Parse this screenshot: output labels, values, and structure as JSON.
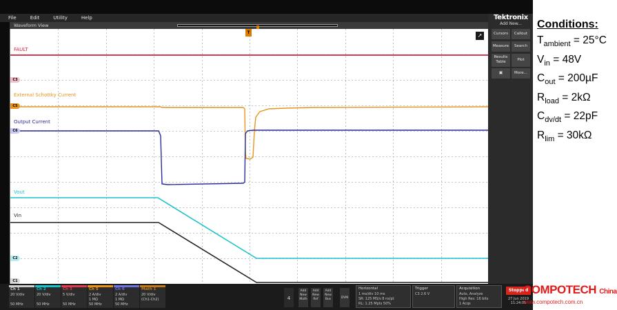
{
  "menu": [
    "File",
    "Edit",
    "Utility",
    "Help"
  ],
  "view_title": "Waveform View",
  "trigger_flag": "T",
  "brand": "Tektronix",
  "add_new": "Add New...",
  "side_buttons": [
    "Cursors",
    "Callout",
    "Measure",
    "Search",
    "Results Table",
    "Plot",
    "More..."
  ],
  "traces": {
    "fault": {
      "label": "FAULT",
      "color": "#d81b3c"
    },
    "schottky": {
      "label": "External Schottky Current",
      "color": "#e8941a"
    },
    "output": {
      "label": "Output Current",
      "color": "#27299b"
    },
    "vout": {
      "label": "Vout",
      "color": "#19c3cc"
    },
    "vin": {
      "label": "Vin",
      "color": "#222222"
    }
  },
  "ch_markers": [
    "C3",
    "C5",
    "C6",
    "C2",
    "C1"
  ],
  "channels": [
    {
      "name": "Ch 1",
      "color": "#cfcfcf",
      "lines": [
        "20 V/div",
        "",
        "50 MHz"
      ]
    },
    {
      "name": "Ch 2",
      "color": "#19c3cc",
      "lines": [
        "20 V/div",
        "",
        "50 MHz"
      ]
    },
    {
      "name": "Ch 3",
      "color": "#e23b52",
      "lines": [
        "5 V/div",
        "",
        "50 MHz"
      ]
    },
    {
      "name": "Ch 5",
      "color": "#e8941a",
      "lines": [
        "2 A/div",
        "1 MΩ",
        "50 MHz"
      ]
    },
    {
      "name": "Ch 6",
      "color": "#6f74e0",
      "lines": [
        "2 A/div",
        "1 MΩ",
        "50 MHz"
      ]
    },
    {
      "name": "Math 1",
      "color": "#c07a1c",
      "lines": [
        "20 V/div",
        "(Ch1-Ch2)",
        ""
      ]
    }
  ],
  "bottom_small": [
    "Add New Math",
    "Add New Ref",
    "Add New Bus",
    "DVM"
  ],
  "channel_count": "4",
  "horizontal": {
    "title": "Horizontal",
    "lines": [
      "1 ms/div      10 ms",
      "SR: 125 MS/s   8 ns/pt",
      "RL: 1.25 Mpts   50%"
    ]
  },
  "trigger": {
    "title": "Trigger",
    "lines": [
      "C3   2.6 V"
    ]
  },
  "acquisition": {
    "title": "Acquisition",
    "lines": [
      "Auto,      Analyze",
      "High Res: 16 bits",
      "1 Acqs"
    ]
  },
  "run_state": "Stopped",
  "date": "27 Jun 2019 11:24:05",
  "conditions": {
    "title": "Conditions:",
    "ambient": {
      "sym": "T",
      "sub": "ambient",
      "val": " = 25°C"
    },
    "vin": {
      "sym": "V",
      "sub": "in",
      "val": " = 48V"
    },
    "cout": {
      "sym": "C",
      "sub": "out",
      "val": "  = 200µF"
    },
    "rload": {
      "sym": "R",
      "sub": "load",
      "val": " = 2kΩ"
    },
    "cdvdt": {
      "sym": "C",
      "sub": "dv/dt",
      "val": " = 22pF"
    },
    "rlim": {
      "sym": "R",
      "sub": "lim",
      "val": " = 30kΩ"
    }
  },
  "watermark": {
    "logo": "COMPOTECH",
    "logo_suffix": "China",
    "url": "www.compotech.com.cn"
  }
}
